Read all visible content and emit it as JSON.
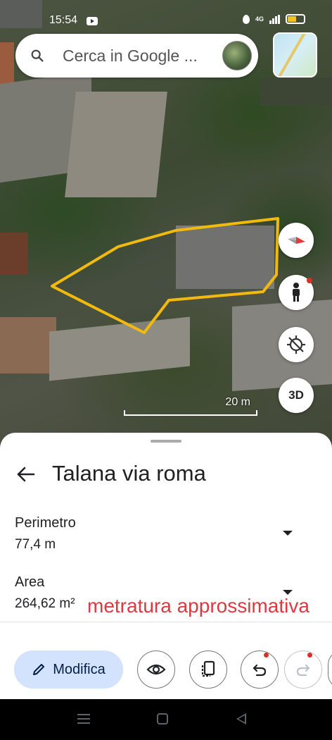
{
  "status_bar": {
    "time": "15:54",
    "network": "4G",
    "icons": [
      "youtube-icon",
      "data-saver-icon",
      "signal-icon",
      "battery-icon"
    ]
  },
  "search": {
    "placeholder": "Cerca in Google ...",
    "icons": [
      "search-icon",
      "avatar",
      "layers-icon"
    ]
  },
  "map_controls": {
    "three_d_label": "3D",
    "icons": [
      "compass-icon",
      "pegman-icon",
      "location-off-icon"
    ]
  },
  "scale": {
    "label": "20 m"
  },
  "measurement": {
    "title": "Talana via roma",
    "perimeter_label": "Perimetro",
    "perimeter_value": "77,4 m",
    "area_label": "Area",
    "area_value": "264,62 m²",
    "annotation": "metratura approssimativa",
    "polygon_color": "#f2b90f"
  },
  "toolbar": {
    "edit_label": "Modifica",
    "icons": [
      "pencil-icon",
      "eye-icon",
      "copy-icon",
      "undo-icon",
      "redo-icon"
    ]
  },
  "colors": {
    "accent": "#d3e3fd",
    "annotation": "#e0383e",
    "badge": "#d93025"
  }
}
